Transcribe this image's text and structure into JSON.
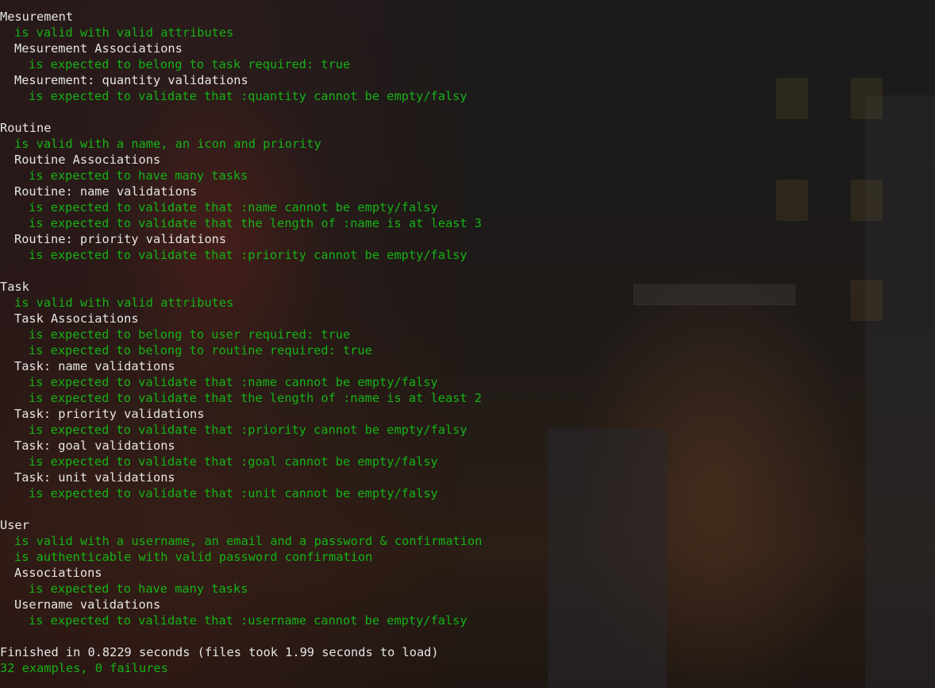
{
  "theme": {
    "text_color": "#e6e6e6",
    "pass_color": "#15b315",
    "background": "#141414"
  },
  "terminal": {
    "groups": [
      {
        "name": "Mesurement",
        "lines": [
          "is valid with valid attributes",
          "Mesurement Associations",
          "is expected to belong to task required: true",
          "Mesurement: quantity validations",
          "is expected to validate that :quantity cannot be empty/falsy"
        ]
      },
      {
        "name": "Routine",
        "lines": [
          "is valid with a name, an icon and priority",
          "Routine Associations",
          "is expected to have many tasks",
          "Routine: name validations",
          "is expected to validate that :name cannot be empty/falsy",
          "is expected to validate that the length of :name is at least 3",
          "Routine: priority validations",
          "is expected to validate that :priority cannot be empty/falsy"
        ]
      },
      {
        "name": "Task",
        "lines": [
          "is valid with valid attributes",
          "Task Associations",
          "is expected to belong to user required: true",
          "is expected to belong to routine required: true",
          "Task: name validations",
          "is expected to validate that :name cannot be empty/falsy",
          "is expected to validate that the length of :name is at least 2",
          "Task: priority validations",
          "is expected to validate that :priority cannot be empty/falsy",
          "Task: goal validations",
          "is expected to validate that :goal cannot be empty/falsy",
          "Task: unit validations",
          "is expected to validate that :unit cannot be empty/falsy"
        ]
      },
      {
        "name": "User",
        "lines": [
          "is valid with a username, an email and a password & confirmation",
          "is authenticable with valid password confirmation",
          "Associations",
          "is expected to have many tasks",
          "Username validations",
          "is expected to validate that :username cannot be empty/falsy"
        ]
      }
    ],
    "finished": "Finished in 0.8229 seconds (files took 1.99 seconds to load)",
    "summary": "32 examples, 0 failures"
  }
}
